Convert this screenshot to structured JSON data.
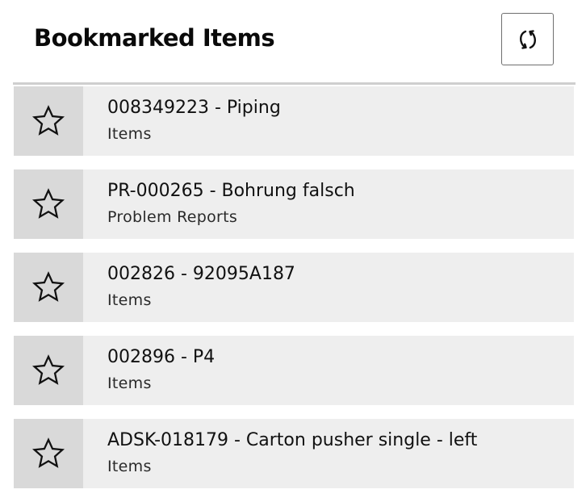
{
  "header": {
    "title": "Bookmarked Items",
    "refresh_icon": "refresh-icon"
  },
  "bookmarks": [
    {
      "title": "008349223 - Piping",
      "subtitle": "Items",
      "icon": "star-outline-icon"
    },
    {
      "title": "PR-000265 - Bohrung falsch",
      "subtitle": "Problem Reports",
      "icon": "star-outline-icon"
    },
    {
      "title": "002826 - 92095A187",
      "subtitle": "Items",
      "icon": "star-outline-icon"
    },
    {
      "title": "002896 - P4",
      "subtitle": "Items",
      "icon": "star-outline-icon"
    },
    {
      "title": "ADSK-018179 - Carton pusher single - left",
      "subtitle": "Items",
      "icon": "star-outline-icon"
    }
  ],
  "colors": {
    "row_background": "#eeeeee",
    "star_cell_background": "#d9d9d9",
    "divider": "#cfcfcf"
  }
}
